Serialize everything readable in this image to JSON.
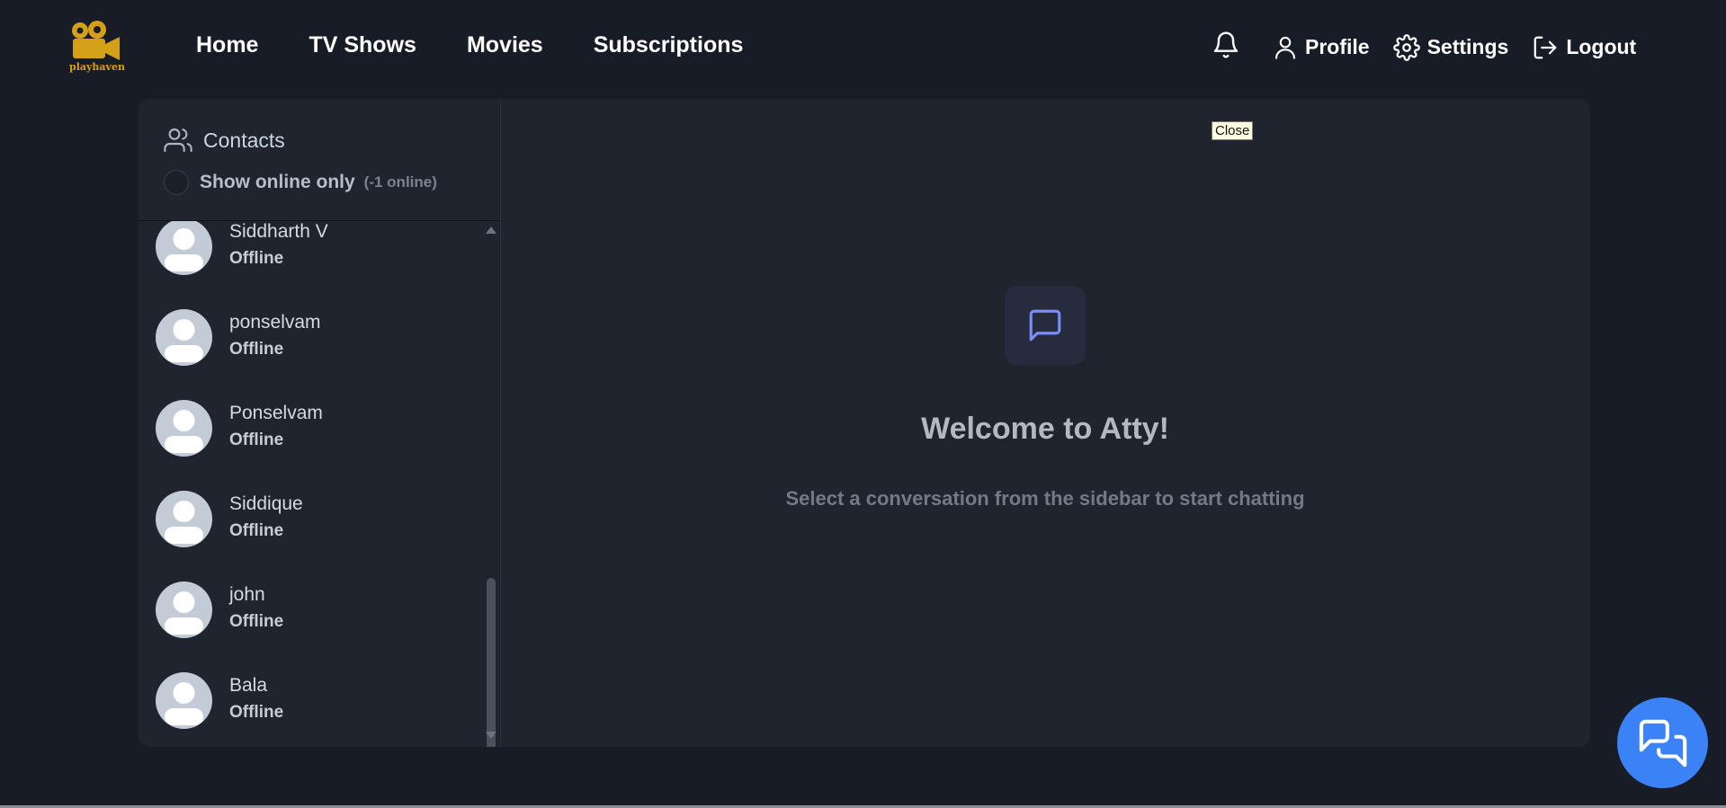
{
  "brand": {
    "name": "playhaven",
    "color": "#d4a017"
  },
  "nav": {
    "links": [
      "Home",
      "TV Shows",
      "Movies",
      "Subscriptions"
    ],
    "profile_label": "Profile",
    "settings_label": "Settings",
    "logout_label": "Logout"
  },
  "sidebar": {
    "title": "Contacts",
    "online_toggle_label": "Show online only",
    "online_count": "(-1 online)",
    "contacts": [
      {
        "name": "Siddharth V",
        "status": "Offline"
      },
      {
        "name": "ponselvam",
        "status": "Offline"
      },
      {
        "name": "Ponselvam",
        "status": "Offline"
      },
      {
        "name": "Siddique",
        "status": "Offline"
      },
      {
        "name": "john",
        "status": "Offline"
      },
      {
        "name": "Bala",
        "status": "Offline"
      }
    ]
  },
  "tooltip": {
    "close": "Close"
  },
  "main": {
    "welcome_title": "Welcome to Atty!",
    "welcome_subtitle": "Select a conversation from the sidebar to start chatting"
  },
  "colors": {
    "background": "#171c27",
    "panel": "#1f242e",
    "accent": "#3b82f6",
    "chat_icon": "#7c8cf8",
    "logo": "#d4a017"
  },
  "icons": {
    "logo": "movie-camera-icon",
    "notifications": "bell-icon",
    "profile": "user-icon",
    "settings": "gear-icon",
    "logout": "logout-icon",
    "contacts": "users-icon",
    "welcome": "message-icon",
    "fab": "chat-bubbles-icon"
  }
}
